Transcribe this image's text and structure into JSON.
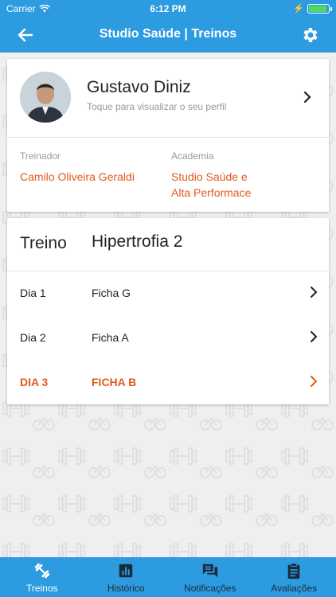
{
  "status_bar": {
    "carrier": "Carrier",
    "time": "6:12 PM"
  },
  "navbar": {
    "title": "Studio Saúde | Treinos"
  },
  "profile": {
    "name": "Gustavo Diniz",
    "hint": "Toque para visualizar o seu perfil",
    "trainer_label": "Treinador",
    "trainer_value": "Camilo Oliveira Geraldi",
    "gym_label": "Academia",
    "gym_value_line1": "Studio Saúde e",
    "gym_value_line2": "Alta Performace"
  },
  "training": {
    "label": "Treino",
    "name": "Hipertrofia 2",
    "rows": [
      {
        "day": "Dia 1",
        "sheet": "Ficha G",
        "active": false
      },
      {
        "day": "Dia 2",
        "sheet": "Ficha A",
        "active": false
      },
      {
        "day": "DIA 3",
        "sheet": "FICHA B",
        "active": true
      }
    ]
  },
  "tabbar": {
    "tabs": [
      {
        "label": "Treinos",
        "icon": "dumbbell-icon",
        "active": true
      },
      {
        "label": "Histórico",
        "icon": "chart-icon",
        "active": false
      },
      {
        "label": "Notificações",
        "icon": "chat-icon",
        "active": false
      },
      {
        "label": "Avaliações",
        "icon": "clipboard-icon",
        "active": false
      }
    ]
  },
  "colors": {
    "brand": "#2d9be0",
    "accent": "#e05a1a"
  }
}
